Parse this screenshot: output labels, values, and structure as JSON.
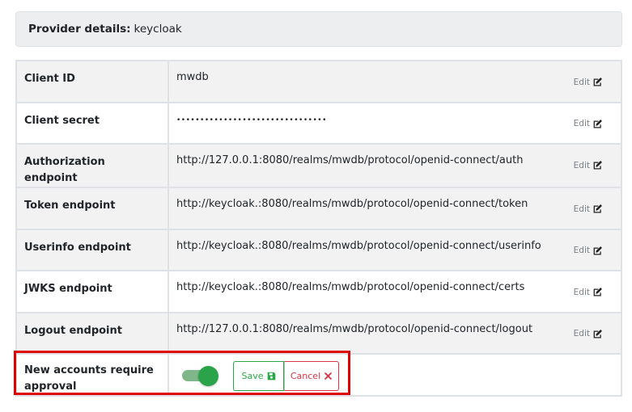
{
  "provider": {
    "label": "Provider details:",
    "name": "keycloak"
  },
  "rows": [
    {
      "key": "Client ID",
      "value": "mwdb",
      "edit": "Edit"
    },
    {
      "key": "Client secret",
      "value": "••••••••••••••••••••••••••••••••",
      "edit": "Edit"
    },
    {
      "key": "Authorization endpoint",
      "value": "http://127.0.0.1:8080/realms/mwdb/protocol/openid-connect/auth",
      "edit": "Edit"
    },
    {
      "key": "Token endpoint",
      "value": "http://keycloak.:8080/realms/mwdb/protocol/openid-connect/token",
      "edit": "Edit"
    },
    {
      "key": "Userinfo endpoint",
      "value": "http://keycloak.:8080/realms/mwdb/protocol/openid-connect/userinfo",
      "edit": "Edit"
    },
    {
      "key": "JWKS endpoint",
      "value": "http://keycloak.:8080/realms/mwdb/protocol/openid-connect/certs",
      "edit": "Edit"
    },
    {
      "key": "Logout endpoint",
      "value": "http://127.0.0.1:8080/realms/mwdb/protocol/openid-connect/logout",
      "edit": "Edit"
    }
  ],
  "approval": {
    "label_line1": "New accounts require",
    "label_line2": "approval",
    "toggle_on": true,
    "save_label": "Save",
    "cancel_label": "Cancel"
  },
  "colors": {
    "save": "#28a745",
    "cancel": "#dc3545",
    "highlight": "#e00000",
    "toggle": "#2aa34a"
  }
}
